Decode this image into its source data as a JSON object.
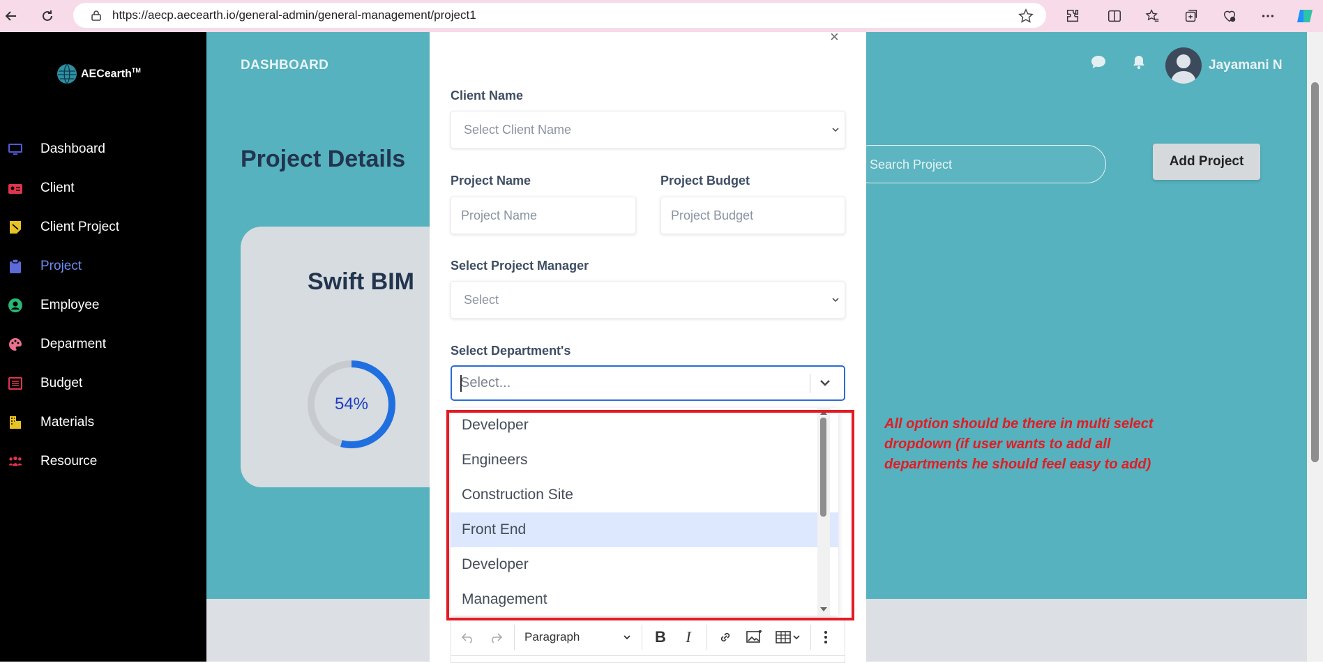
{
  "browser": {
    "url": "https://aecp.aecearth.io/general-admin/general-management/project1",
    "icons": [
      "back-icon",
      "refresh-icon",
      "lock-icon",
      "star-icon",
      "extensions-icon",
      "split-screen-icon",
      "favorites-icon",
      "collections-icon",
      "browser-essentials-icon",
      "more-icon",
      "copilot-icon"
    ]
  },
  "sidebar": {
    "brand": "AECearth",
    "trademark": "TM",
    "items": [
      {
        "label": "Dashboard",
        "icon": "monitor-icon",
        "color": "#4f5bd5",
        "active": false
      },
      {
        "label": "Client",
        "icon": "contact-card-icon",
        "color": "#e0344d",
        "active": false
      },
      {
        "label": "Client Project",
        "icon": "sticky-note-icon",
        "color": "#e6c224",
        "active": false
      },
      {
        "label": "Project",
        "icon": "clipboard-icon",
        "color": "#5c6bd8",
        "active": true
      },
      {
        "label": "Employee",
        "icon": "user-circle-icon",
        "color": "#2bb673",
        "active": false
      },
      {
        "label": "Deparment",
        "icon": "palette-icon",
        "color": "#e8728f",
        "active": false
      },
      {
        "label": "Budget",
        "icon": "ledger-icon",
        "color": "#e0344d",
        "active": false
      },
      {
        "label": "Materials",
        "icon": "building-icon",
        "color": "#e6c224",
        "active": false
      },
      {
        "label": "Resource",
        "icon": "people-group-icon",
        "color": "#e0344d",
        "active": false
      }
    ]
  },
  "header": {
    "dashboard_label": "DASHBOARD",
    "user_name": "Jayamani N"
  },
  "main": {
    "page_title": "Project Details",
    "search_placeholder": "Search Project",
    "add_button": "Add Project",
    "project_card": {
      "title": "Swift BIM",
      "progress_label": "54%",
      "progress": 0.54
    }
  },
  "modal": {
    "client_name_label": "Client Name",
    "client_name_placeholder": "Select Client Name",
    "project_name_label": "Project Name",
    "project_name_placeholder": "Project Name",
    "project_budget_label": "Project Budget",
    "project_budget_placeholder": "Project Budget",
    "manager_label": "Select Project Manager",
    "manager_placeholder": "Select",
    "department_label": "Select Department's",
    "department_placeholder": "Select...",
    "department_options": [
      "Developer",
      "Engineers",
      "Construction Site",
      "Front End",
      "Developer",
      "Management"
    ],
    "highlighted_option_index": 3,
    "editor": {
      "paragraph_label": "Paragraph"
    }
  },
  "annotation": {
    "text": "All option should be there in multi select dropdown (if user wants to add all departments he should feel easy to add)",
    "color": "#e31b23"
  },
  "colors": {
    "accent_teal": "#55b2be",
    "sidebar_bg": "#000000",
    "focus_blue": "#2a6bd8"
  }
}
